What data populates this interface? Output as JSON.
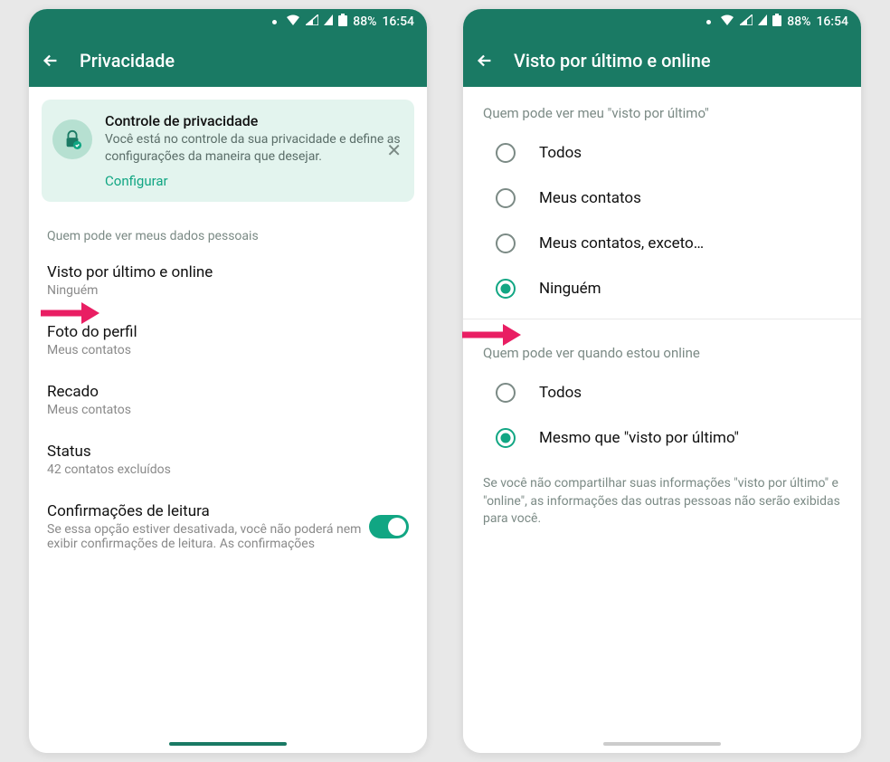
{
  "status": {
    "battery": "88%",
    "time": "16:54"
  },
  "screen1": {
    "header_title": "Privacidade",
    "banner": {
      "title": "Controle de privacidade",
      "text": "Você está no controle da sua privacidade e define as configurações da maneira que desejar.",
      "link": "Configurar"
    },
    "section_label": "Quem pode ver meus dados pessoais",
    "items": [
      {
        "title": "Visto por último e online",
        "sub": "Ninguém"
      },
      {
        "title": "Foto do perfil",
        "sub": "Meus contatos"
      },
      {
        "title": "Recado",
        "sub": "Meus contatos"
      },
      {
        "title": "Status",
        "sub": "42 contatos excluídos"
      }
    ],
    "read_receipts": {
      "title": "Confirmações de leitura",
      "sub": "Se essa opção estiver desativada, você não poderá nem exibir confirmações de leitura. As confirmações"
    }
  },
  "screen2": {
    "header_title": "Visto por último e online",
    "section1_label": "Quem pode ver meu \"visto por último\"",
    "options1": [
      {
        "label": "Todos",
        "selected": false
      },
      {
        "label": "Meus contatos",
        "selected": false
      },
      {
        "label": "Meus contatos, exceto…",
        "selected": false
      },
      {
        "label": "Ninguém",
        "selected": true
      }
    ],
    "section2_label": "Quem pode ver quando estou online",
    "options2": [
      {
        "label": "Todos",
        "selected": false
      },
      {
        "label": "Mesmo que \"visto por último\"",
        "selected": true
      }
    ],
    "info": "Se você não compartilhar suas informações \"visto por último\" e \"online\", as informações das outras pessoas não serão exibidas para você."
  }
}
